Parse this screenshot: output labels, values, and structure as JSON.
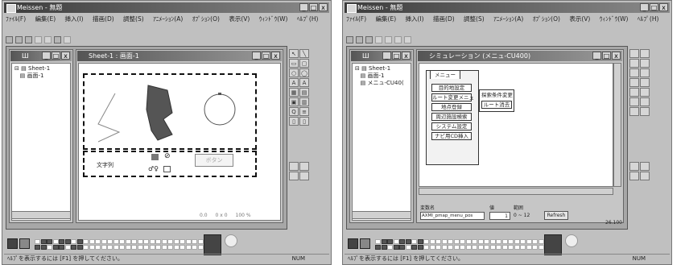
{
  "left": {
    "title": "Meissen - 無題",
    "menu": [
      "ﾌｧｲﾙ(F)",
      "編集(E)",
      "挿入(I)",
      "描画(D)",
      "調整(S)",
      "ｱﾆﾒｰｼｮﾝ(A)",
      "ｵﾌﾟｼｮﾝ(O)",
      "表示(V)",
      "ｳｨﾝﾄﾞｳ(W)",
      "ﾍﾙﾌﾟ(H)"
    ],
    "tree_title": "Ш",
    "tree": [
      "Sheet-1",
      "画面-1"
    ],
    "doc_title": "Sheet-1 : 画面-1",
    "widgets": {
      "text_label": "文字列",
      "button_label": "ボタン"
    },
    "ruler": [
      "0.0",
      "0 x 0",
      "100 %"
    ],
    "status": "ﾍﾙﾌﾟを表示するには [F1] を押してください。",
    "status_num": "NUM"
  },
  "right": {
    "title": "Meissen - 無題",
    "menu": [
      "ﾌｧｲﾙ(F)",
      "編集(E)",
      "挿入(I)",
      "描画(D)",
      "調整(S)",
      "ｱﾆﾒｰｼｮﾝ(A)",
      "ｵﾌﾟｼｮﾝ(O)",
      "表示(V)",
      "ｳｨﾝﾄﾞｳ(W)",
      "ﾍﾙﾌﾟ(H)"
    ],
    "tree_title": "Ш",
    "tree": [
      "Sheet-1",
      "画面-1",
      "メニュ-CU40("
    ],
    "doc_title": "シミュレーション (メニュ-CU400)",
    "menu_tab": "メニュー",
    "menu_items": [
      "目的地設定",
      "ルート変更メニュ",
      "地点登録",
      "周辺施設検索",
      "システム設定",
      "ナビ用CD挿入"
    ],
    "sub_items": [
      "探索条件変更",
      "ルート消去"
    ],
    "fields": {
      "var_label": "変数名",
      "value_label": "値",
      "range_label": "範囲",
      "var_value": "AXMI_pmap_menu_pos",
      "value_val": "1",
      "range_val": "0 ~ 12",
      "refresh": "Refresh"
    },
    "scale": "26.100",
    "status": "ﾍﾙﾌﾟを表示するには [F1] を押してください。",
    "status_num": "NUM"
  }
}
